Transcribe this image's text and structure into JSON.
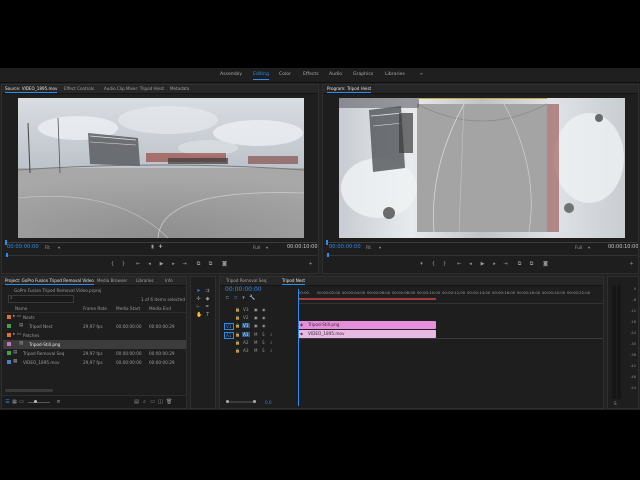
{
  "workspaces": [
    {
      "label": "Assembly",
      "active": false
    },
    {
      "label": "Editing",
      "active": true
    },
    {
      "label": "Color",
      "active": false
    },
    {
      "label": "Effects",
      "active": false
    },
    {
      "label": "Audio",
      "active": false
    },
    {
      "label": "Graphics",
      "active": false
    },
    {
      "label": "Libraries",
      "active": false
    },
    {
      "label": "»",
      "active": false
    }
  ],
  "source_monitor": {
    "tabs": [
      "Source: VIDEO_1895.mov",
      "Effect Controls",
      "Audio Clip Mixer: Tripod Heist",
      "Metadata"
    ],
    "timecode": "00:00:00:00",
    "fit": "Fit",
    "quality": "Full",
    "duration": "00:00:10:00"
  },
  "program_monitor": {
    "tabs": [
      "Program: Tripod Heist"
    ],
    "timecode": "00:00:00:00",
    "fit": "Fit",
    "quality": "Full",
    "duration": "00:00:10:00"
  },
  "project_panel": {
    "tabs": [
      "Project: GoPro Fusion Tripod Removal Video",
      "Media Browser",
      "Libraries",
      "Info"
    ],
    "project_file": "GoPro Fusion Tripod Removal Video.prproj",
    "selection_info": "1 of 6 items selected",
    "columns": [
      "Name",
      "Frame Rate",
      "Media Start",
      "Media End"
    ],
    "rows": [
      {
        "name": "Nests",
        "frame_rate": "",
        "media_start": "",
        "media_end": "",
        "color": "#e0702a",
        "kind": "bin",
        "indent": 1,
        "selected": false
      },
      {
        "name": "Tripod Nest",
        "frame_rate": "29,97 fps",
        "media_start": "00:00:00:00",
        "media_end": "00:00:00:29",
        "color": "#3fa34d",
        "kind": "seq",
        "indent": 2,
        "selected": false
      },
      {
        "name": "Patches",
        "frame_rate": "",
        "media_start": "",
        "media_end": "",
        "color": "#e0702a",
        "kind": "bin",
        "indent": 1,
        "selected": false
      },
      {
        "name": "Tripod-Still.png",
        "frame_rate": "",
        "media_start": "",
        "media_end": "",
        "color": "#c96fbd",
        "kind": "image",
        "indent": 2,
        "selected": true
      },
      {
        "name": "Tripod Removal Seq",
        "frame_rate": "29,97 fps",
        "media_start": "00:00:00:00",
        "media_end": "00:00:00:29",
        "color": "#3fa34d",
        "kind": "seq",
        "indent": 1,
        "selected": false
      },
      {
        "name": "VIDEO_1895.mov",
        "frame_rate": "29,97 fps",
        "media_start": "00:00:00:00",
        "media_end": "00:00:00:29",
        "color": "#4a7fd0",
        "kind": "clip",
        "indent": 1,
        "selected": false
      }
    ]
  },
  "timeline": {
    "tabs": [
      "Tripod Removal Seq",
      "Tripod Nest"
    ],
    "timecode": "00:00:00:00",
    "ruler": [
      "00:00",
      "00:00:02:00",
      "00:00:04:00",
      "00:00:06:00",
      "00:00:08:00",
      "00:00:10:00",
      "00:00:12:00",
      "00:00:14:00",
      "00:00:16:00",
      "00:00:18:00",
      "00:00:20:00",
      "00:00:22:00"
    ],
    "tracks": [
      {
        "name": "V3",
        "source": ""
      },
      {
        "name": "V2",
        "source": ""
      },
      {
        "name": "V1",
        "source": "V1"
      },
      {
        "name": "A1",
        "source": "A1"
      },
      {
        "name": "A2",
        "source": ""
      },
      {
        "name": "A3",
        "source": ""
      }
    ],
    "clips": [
      {
        "label": "Tripod-Still.png",
        "track": "V2",
        "color": "#e58ed9"
      },
      {
        "label": "VIDEO_1895.mov",
        "track": "V1",
        "color": "#e8b9e2"
      }
    ],
    "master_value": "0.0"
  },
  "audio_meter": {
    "scale": [
      "0",
      "-6",
      "-12",
      "-18",
      "-24",
      "-30",
      "-36",
      "-42",
      "-48",
      "-54"
    ],
    "solo": "S"
  }
}
